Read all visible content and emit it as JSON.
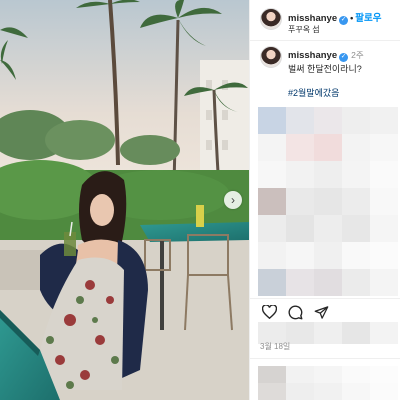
{
  "post": {
    "username": "misshanye",
    "follow_label": "팔로우",
    "separator": "•",
    "location": "푸꾸옥 섬",
    "caption_time": "2주",
    "caption_text": "벌써 한달전이라니?",
    "hashtag": "#2월말에갔음",
    "date": "3월 18일"
  },
  "icons": {
    "verified": "verified-badge-icon",
    "next": "chevron-right-icon",
    "like": "heart-icon",
    "comment": "comment-icon",
    "share": "send-icon"
  },
  "colors": {
    "follow": "#0095f6",
    "verified": "#3897f0",
    "hashtag": "#00376b",
    "muted": "#8e8e8e"
  }
}
